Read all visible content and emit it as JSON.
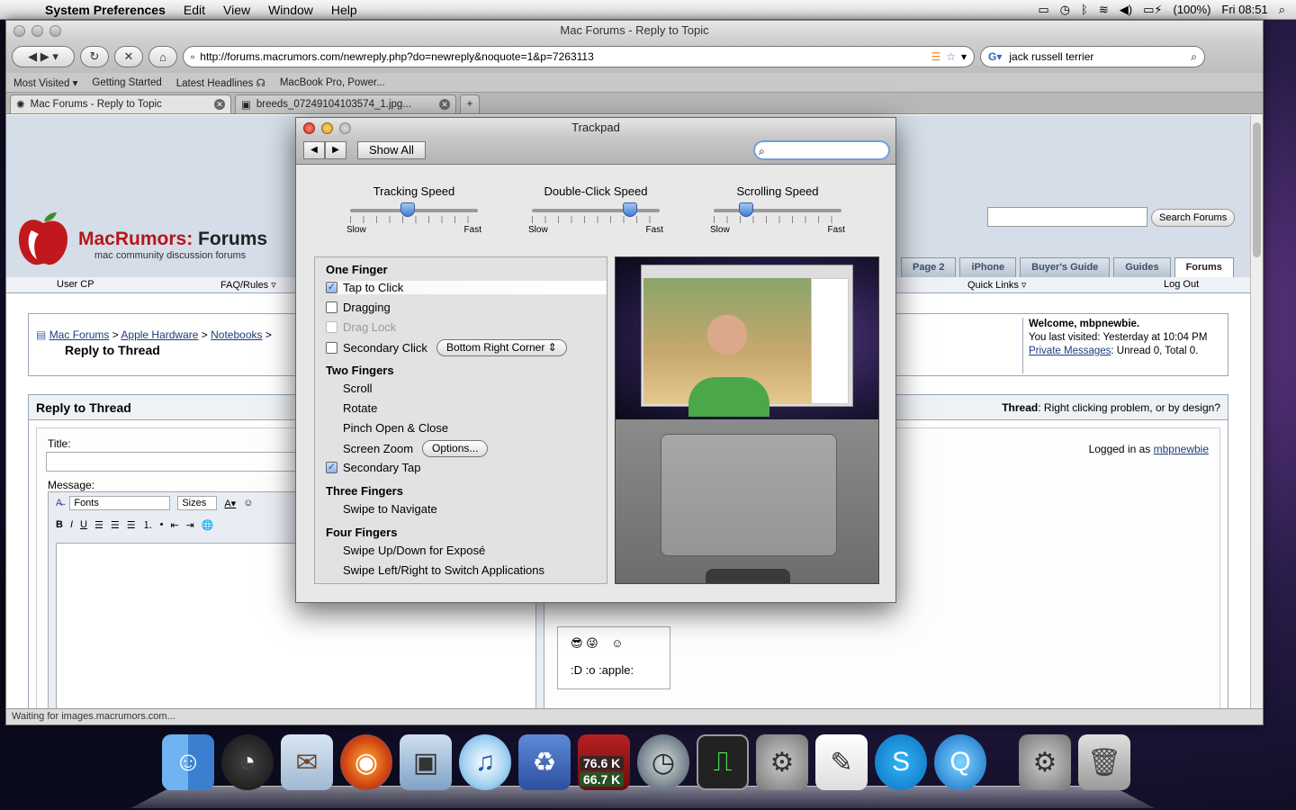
{
  "menubar": {
    "app": "System Preferences",
    "items": [
      "Edit",
      "View",
      "Window",
      "Help"
    ],
    "battery": "(100%)",
    "clock": "Fri 08:51"
  },
  "browser": {
    "title": "Mac Forums - Reply to Topic",
    "url": "http://forums.macrumors.com/newreply.php?do=newreply&noquote=1&p=7263113",
    "search_value": "jack russell terrier",
    "bookmarks": [
      "Most Visited ▾",
      "Getting Started",
      "Latest Headlines ☊",
      "MacBook Pro, Power..."
    ],
    "tabs": [
      {
        "label": "Mac Forums - Reply to Topic"
      },
      {
        "label": "breeds_07249104103574_1.jpg..."
      }
    ],
    "status": "Waiting for images.macrumors.com..."
  },
  "site": {
    "logo_prefix": "MacRumors:",
    "logo_suffix": " Forums",
    "tagline": "mac community discussion forums",
    "search_button": "Search Forums",
    "nav_tabs": [
      "Page 2",
      "iPhone",
      "Buyer's Guide",
      "Guides",
      "Forums"
    ],
    "nav_links": {
      "user_cp": "User CP",
      "faq": "FAQ/Rules ▿",
      "quick_links": "Quick Links ▿",
      "logout": "Log Out"
    },
    "breadcrumb": [
      "Mac Forums",
      "Apple Hardware",
      "Notebooks"
    ],
    "page_heading": "Reply to Thread",
    "welcome": {
      "title": "Welcome, mbpnewbie.",
      "last_visit": "You last visited: Yesterday at 10:04 PM",
      "pm_link": "Private Messages",
      "pm_status": ": Unread 0, Total 0."
    },
    "reply_header": "Reply to Thread",
    "thread_label": "Thread",
    "thread_title": ": Right clicking problem, or by design?",
    "title_label": "Title:",
    "message_label": "Message:",
    "logged_in_prefix": "Logged in as ",
    "logged_in_user": "mbpnewbie",
    "font_select": "Fonts",
    "size_select": "Sizes",
    "smilies_text": ":D  :o  :apple:"
  },
  "prefs": {
    "title": "Trackpad",
    "show_all": "Show All",
    "sliders": [
      {
        "label": "Tracking Speed",
        "min": "Slow",
        "max": "Fast",
        "level": 0.45
      },
      {
        "label": "Double-Click Speed",
        "min": "Slow",
        "max": "Fast",
        "level": 0.77
      },
      {
        "label": "Scrolling Speed",
        "min": "Slow",
        "max": "Fast",
        "level": 0.25
      }
    ],
    "gestures": {
      "one_finger": "One Finger",
      "tap_to_click": "Tap to Click",
      "dragging": "Dragging",
      "drag_lock": "Drag Lock",
      "secondary_click": "Secondary Click",
      "secondary_click_value": "Bottom Right Corner",
      "two_fingers": "Two Fingers",
      "scroll": "Scroll",
      "rotate": "Rotate",
      "pinch": "Pinch Open & Close",
      "screen_zoom": "Screen Zoom",
      "options": "Options...",
      "secondary_tap": "Secondary Tap",
      "three_fingers": "Three Fingers",
      "swipe_navigate": "Swipe to Navigate",
      "four_fingers": "Four Fingers",
      "expose": "Swipe Up/Down for Exposé",
      "switch_apps": "Swipe Left/Right to Switch Applications"
    }
  },
  "dock": {
    "net_up": "76.6 K",
    "net_down": "66.7 K",
    "icons": [
      "finder-icon",
      "dashboard-icon",
      "mail-icon",
      "firefox-icon",
      "iphoto-icon",
      "itunes-icon",
      "recycle-icon",
      "network-monitor-icon",
      "time-machine-icon",
      "activity-monitor-icon",
      "system-preferences-icon",
      "textedit-icon",
      "skype-icon",
      "quicktime-icon",
      "system-preferences-2-icon",
      "trash-icon"
    ]
  }
}
